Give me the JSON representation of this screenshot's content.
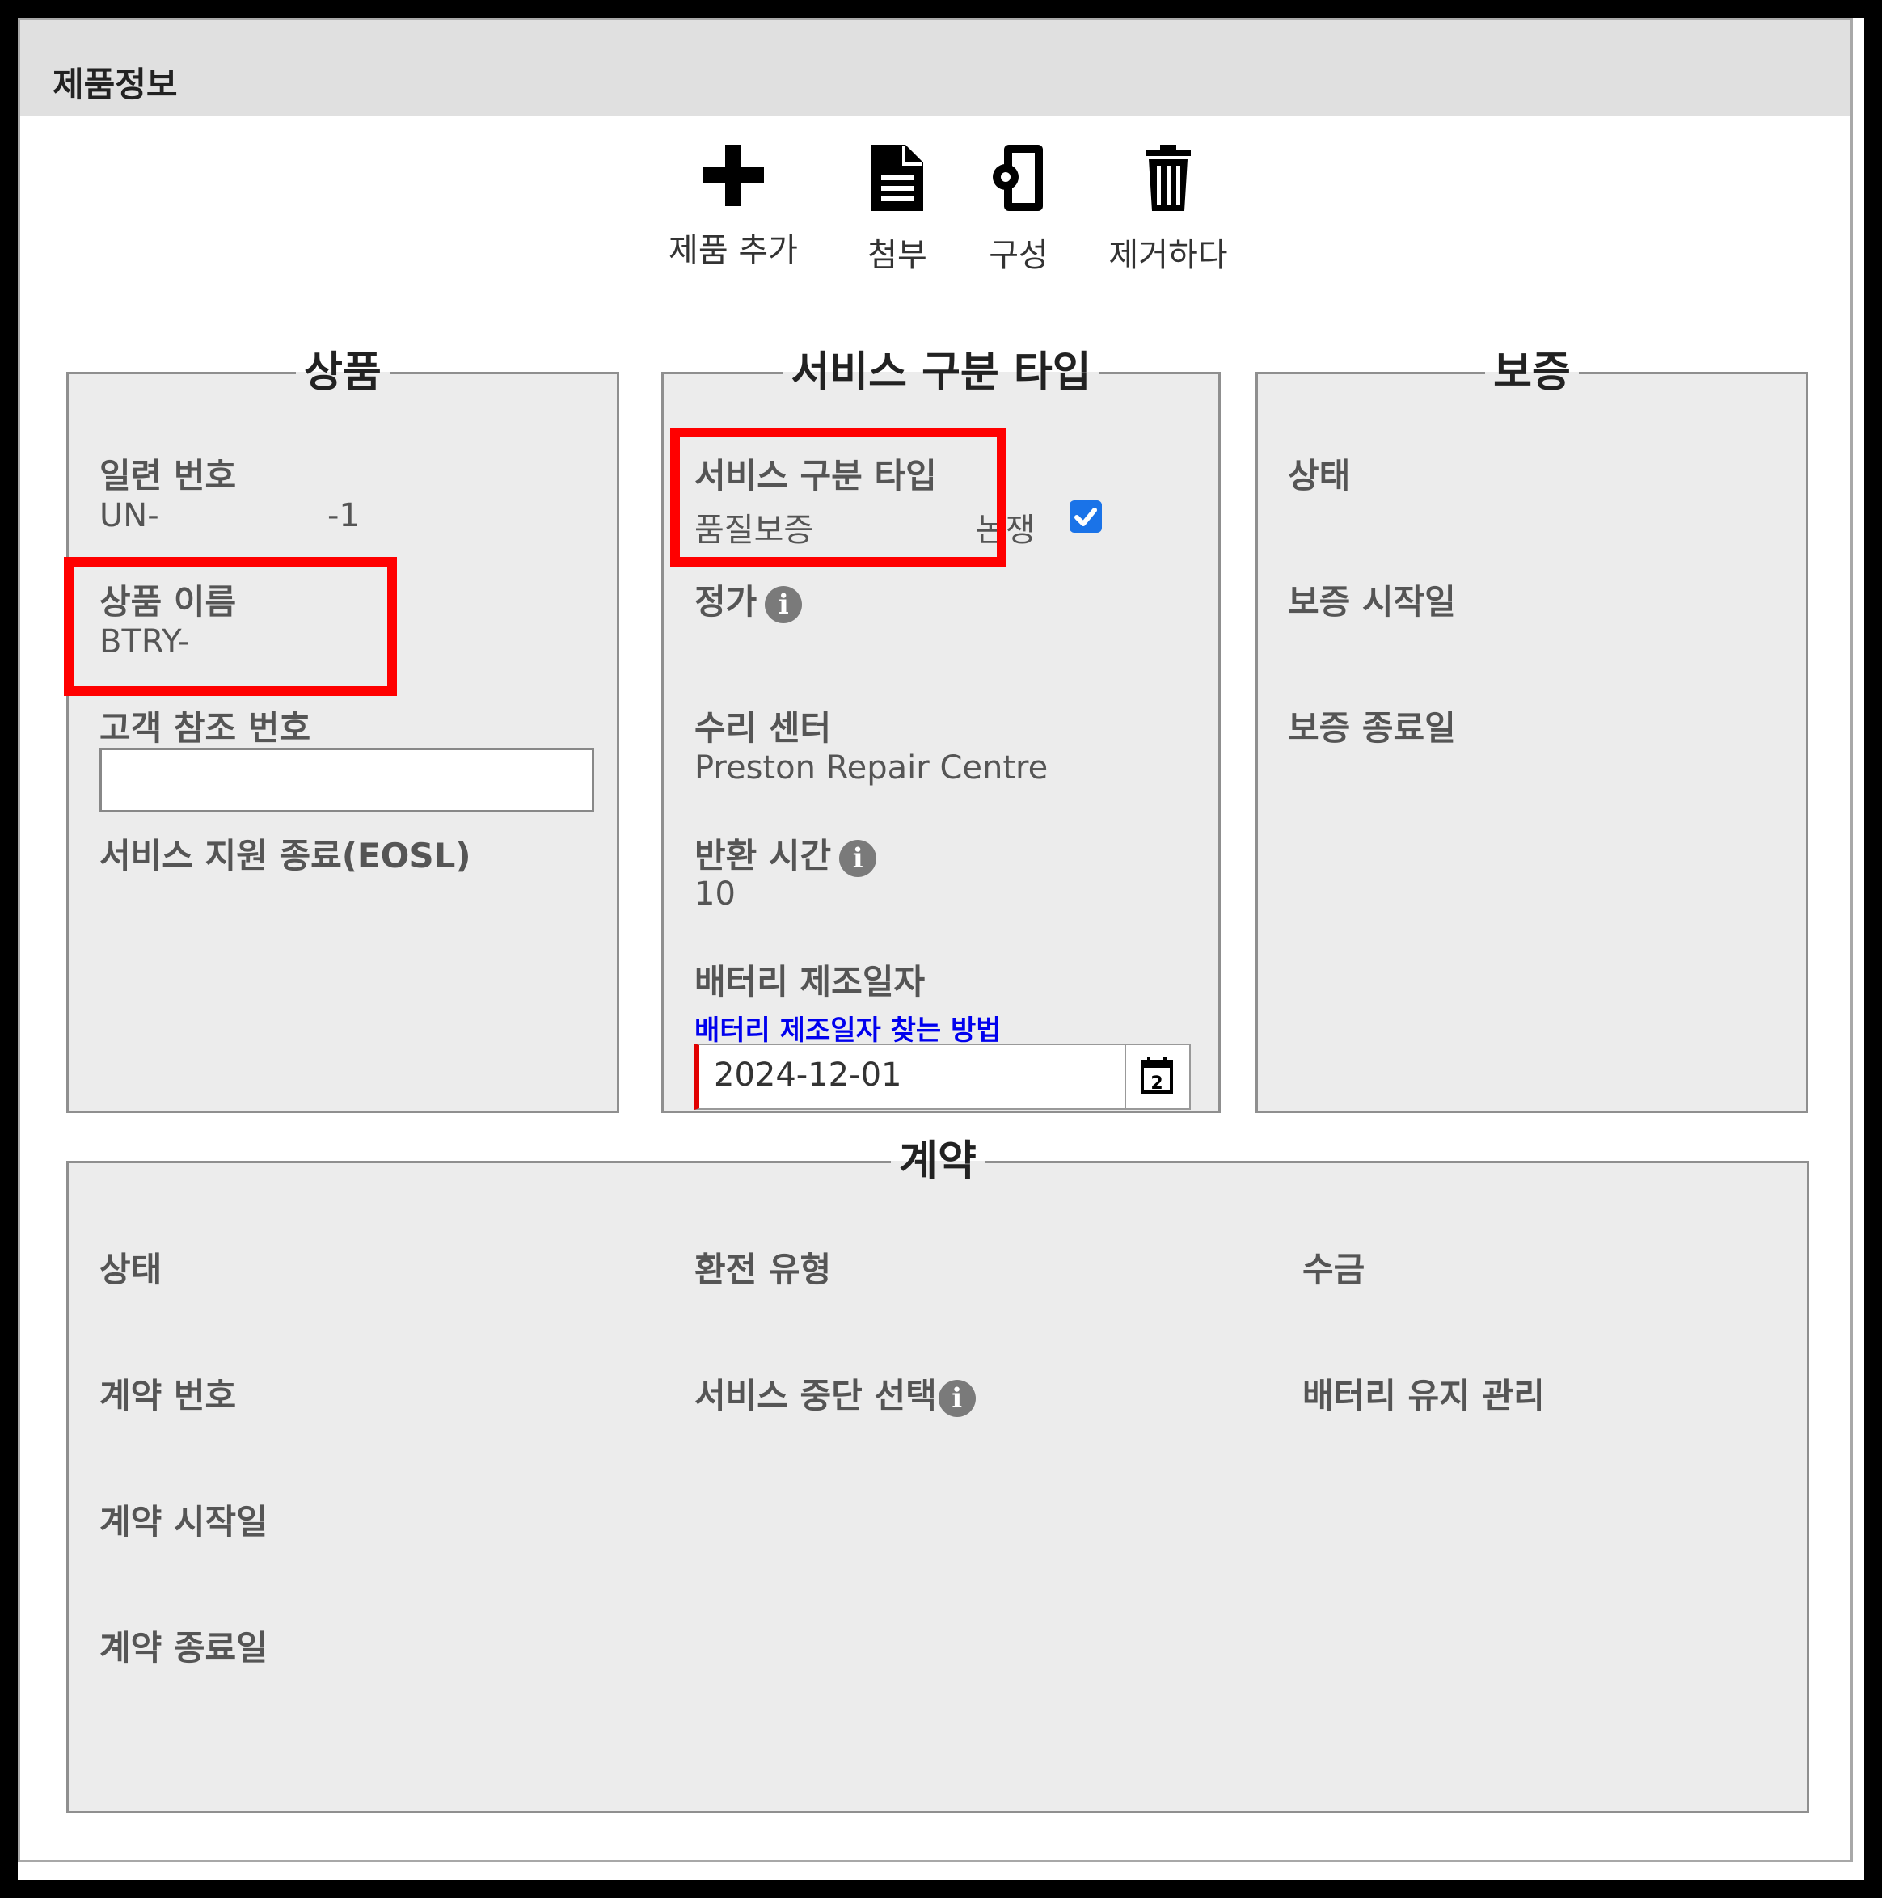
{
  "panel": {
    "title": "제품정보"
  },
  "toolbar": {
    "add_label": "제품 추가",
    "attach_label": "첨부",
    "config_label": "구성",
    "remove_label": "제거하다"
  },
  "product": {
    "legend": "상품",
    "serial_label": "일련 번호",
    "serial_prefix": "UN-",
    "serial_suffix": "-1",
    "name_label": "상품 이름",
    "name_value": "BTRY-",
    "customer_ref_label": "고객 참조 번호",
    "customer_ref_value": "",
    "eosl_label": "서비스 지원 종료(EOSL)"
  },
  "service": {
    "legend": "서비스 구분 타입",
    "type_label": "서비스 구분 타입",
    "type_value": "품질보증",
    "dispute_label": "논쟁",
    "dispute_checked": true,
    "price_label": "정가",
    "repair_center_label": "수리 센터",
    "repair_center_value": "Preston Repair Centre",
    "turnaround_label": "반환 시간",
    "turnaround_value": "10",
    "battery_date_label": "배터리 제조일자",
    "battery_date_help": "배터리 제조일자 찾는 방법",
    "battery_date_value": "2024-12-01"
  },
  "warranty": {
    "legend": "보증",
    "status_label": "상태",
    "start_label": "보증 시작일",
    "end_label": "보증 종료일"
  },
  "contract": {
    "legend": "계약",
    "status_label": "상태",
    "refund_type_label": "환전 유형",
    "billing_label": "수금",
    "number_label": "계약 번호",
    "service_stop_label": "서비스 중단 선택",
    "battery_maint_label": "배터리 유지 관리",
    "start_label": "계약 시작일",
    "end_label": "계약 종료일"
  },
  "colors": {
    "highlight": "#ff0000",
    "link": "#0000ee",
    "checkbox": "#1a73e8",
    "required_marker": "#e10000"
  },
  "icons": {
    "add": "plus-icon",
    "attach": "document-icon",
    "config": "phone-gear-icon",
    "remove": "trash-icon",
    "info": "info-icon",
    "calendar": "calendar-icon"
  }
}
